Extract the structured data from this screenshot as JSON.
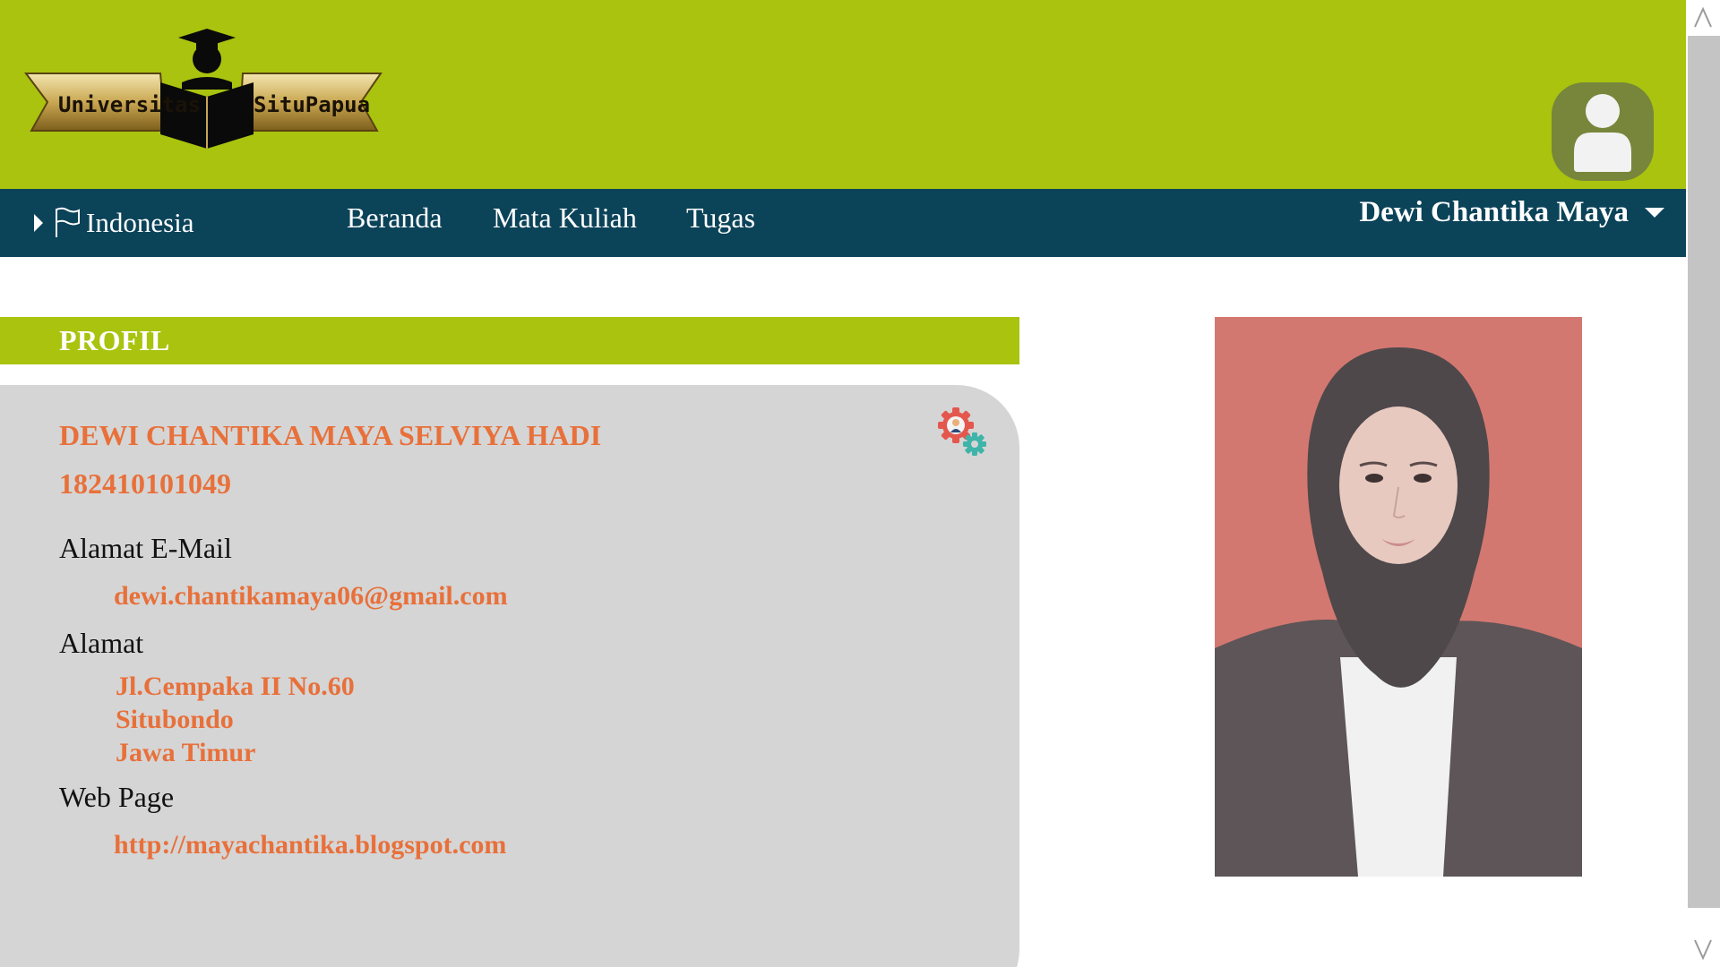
{
  "header": {
    "logo": {
      "word_left": "Universitas",
      "word_right": "SituPapua",
      "icon": "graduate-with-book-logo"
    },
    "avatar_icon": "user-avatar-icon"
  },
  "nav": {
    "language": {
      "label": "Indonesia",
      "icons": [
        "caret-right-icon",
        "flag-icon"
      ]
    },
    "links": [
      {
        "label": "Beranda"
      },
      {
        "label": "Mata Kuliah"
      },
      {
        "label": "Tugas"
      }
    ],
    "user_menu": {
      "name": "Dewi Chantika Maya",
      "icon": "caret-down-icon"
    }
  },
  "profile": {
    "section_title": "PROFIL",
    "full_name": "DEWI CHANTIKA MAYA SELVIYA HADI",
    "student_id": "182410101049",
    "email_label": "Alamat E-Mail",
    "email": "dewi.chantikamaya06@gmail.com",
    "address_label": "Alamat",
    "address_lines": [
      "Jl.Cempaka II No.60",
      "Situbondo",
      "Jawa Timur"
    ],
    "web_label": "Web Page",
    "web": "http://mayachantika.blogspot.com",
    "settings_icon": "user-settings-gear-icon"
  },
  "photo": {
    "icon": "profile-photo"
  },
  "colors": {
    "brand_green": "#a9c30f",
    "nav_blue": "#0b4359",
    "accent_orange": "#e8703a",
    "card_gray": "#d5d5d5",
    "avatar_bg": "#77863b",
    "photo_bg": "#d37870"
  }
}
